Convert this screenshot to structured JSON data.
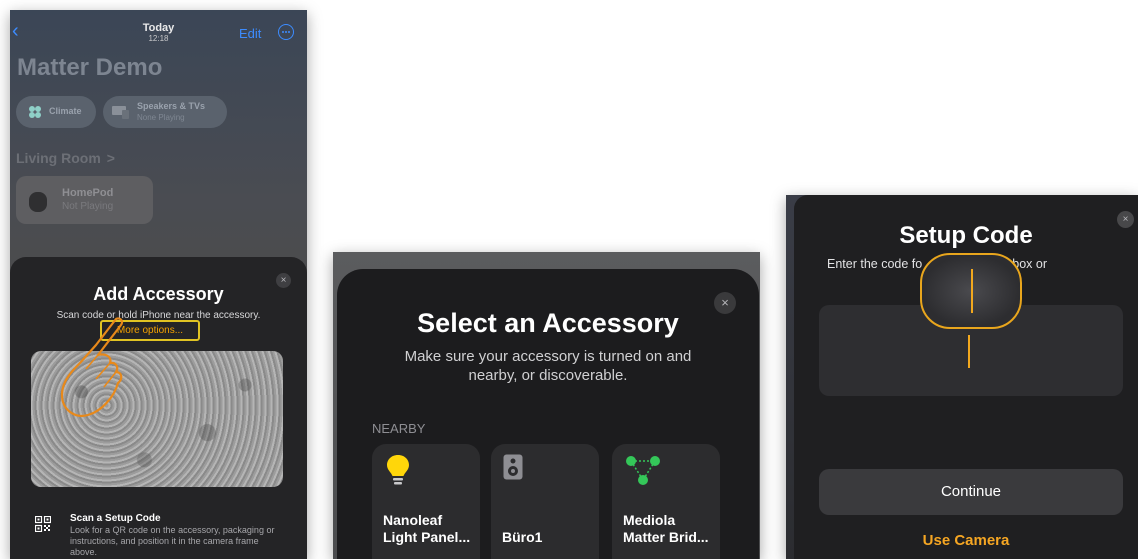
{
  "screen1": {
    "top_title": "Today",
    "top_time": "12:18",
    "edit_label": "Edit",
    "home_title": "Matter Demo",
    "chips": {
      "climate": "Climate",
      "speakers_title": "Speakers & TVs",
      "speakers_sub": "None Playing"
    },
    "room_title": "Living Room",
    "room_chevron": ">",
    "tile": {
      "name": "HomePod",
      "status": "Not Playing"
    },
    "sheet": {
      "close": "×",
      "title": "Add Accessory",
      "subtitle": "Scan code or hold iPhone near the accessory.",
      "more_options": "More options...",
      "scan_title": "Scan a Setup Code",
      "scan_desc": "Look for a QR code on the accessory, packaging or instructions, and position it in the camera frame above."
    }
  },
  "screen2": {
    "close": "×",
    "title": "Select an Accessory",
    "subtitle": "Make sure your accessory is turned on and nearby, or discoverable.",
    "section": "NEARBY",
    "accessories": [
      {
        "name": "Nanoleaf Light Panel...",
        "icon": "bulb-icon"
      },
      {
        "name": "Büro1",
        "icon": "speaker-icon"
      },
      {
        "name": "Mediola Matter Brid...",
        "icon": "bridge-icon"
      }
    ]
  },
  "screen3": {
    "close": "×",
    "title": "Setup Code",
    "subtitle": "Enter the code fo          ccessory, box or",
    "continue_label": "Continue",
    "use_camera_label": "Use Camera"
  },
  "colors": {
    "ios_blue": "#3d8cff",
    "annotation_yellow": "#e0c323",
    "orange_accent": "#f5a623",
    "sheet_dark": "#1c1c1e"
  }
}
